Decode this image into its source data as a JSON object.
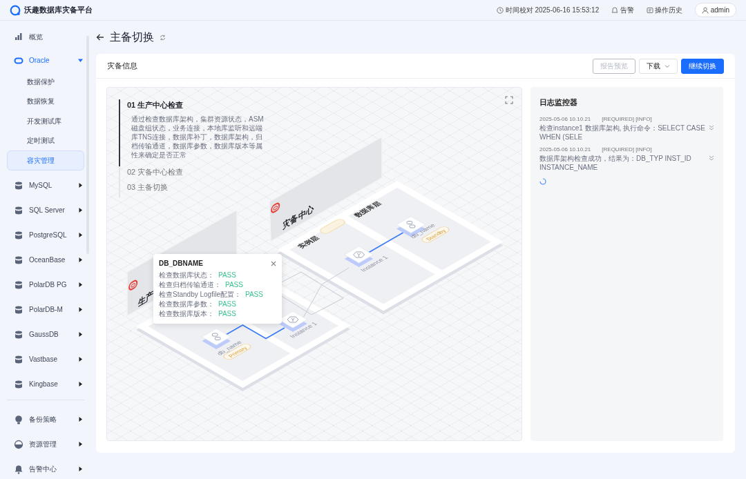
{
  "app": {
    "title": "沃趣数据库灾备平台"
  },
  "header": {
    "time": "时间校对 2025-06-16 15:53:12",
    "alarm": "告警",
    "history": "操作历史",
    "user": "admin"
  },
  "sidebar": {
    "groups": [
      [
        {
          "label": "概览",
          "kind": "link",
          "selected": false
        },
        {
          "label": "Oracle",
          "kind": "menu",
          "selected": true,
          "expanded": true,
          "children": [
            {
              "label": "数据保护",
              "selected": false
            },
            {
              "label": "数据恢复",
              "selected": false
            },
            {
              "label": "开发测试库",
              "selected": false
            },
            {
              "label": "定时测试",
              "selected": false
            },
            {
              "label": "容灾管理",
              "selected": true
            }
          ]
        },
        {
          "label": "MySQL",
          "kind": "menu",
          "selected": false,
          "expanded": false
        },
        {
          "label": "SQL Server",
          "kind": "menu",
          "selected": false,
          "expanded": false
        },
        {
          "label": "PostgreSQL",
          "kind": "menu",
          "selected": false,
          "expanded": false
        },
        {
          "label": "OceanBase",
          "kind": "menu",
          "selected": false,
          "expanded": false
        },
        {
          "label": "PolarDB PG",
          "kind": "menu",
          "selected": false,
          "expanded": false
        },
        {
          "label": "PolarDB-M",
          "kind": "menu",
          "selected": false,
          "expanded": false
        },
        {
          "label": "GaussDB",
          "kind": "menu",
          "selected": false,
          "expanded": false
        },
        {
          "label": "Vastbase",
          "kind": "menu",
          "selected": false,
          "expanded": false
        },
        {
          "label": "Kingbase",
          "kind": "menu",
          "selected": false,
          "expanded": false
        }
      ],
      [
        {
          "label": "备份策略",
          "kind": "menu",
          "selected": false,
          "expanded": false
        },
        {
          "label": "资源管理",
          "kind": "menu",
          "selected": false,
          "expanded": false
        },
        {
          "label": "告警中心",
          "kind": "menu",
          "selected": false,
          "expanded": false
        }
      ]
    ]
  },
  "page": {
    "title": "主备切换"
  },
  "card": {
    "title": "灾备信息",
    "buttons": [
      {
        "label": "报告预览",
        "kind": "outline",
        "disabled": true
      },
      {
        "label": "下载",
        "kind": "dropdown",
        "disabled": false
      },
      {
        "label": "继续切换",
        "kind": "primary",
        "disabled": false
      }
    ]
  },
  "steps": [
    {
      "label": "01 生产中心检查",
      "selected": true,
      "description": "通过检查数据库架构，集群资源状态，ASM磁盘组状态，业务连接，本地库监听和远端库TNS连接，数据库补丁，数据库架构，归档传输通道，数据库参数，数据库版本等属性来确定是否正常"
    },
    {
      "label": "02 灾备中心检查",
      "selected": false
    },
    {
      "label": "03 主备切换",
      "selected": false
    }
  ],
  "diagram": {
    "sites": [
      {
        "kind": "standby",
        "title": "灾备中心",
        "database_layer": "数据库层",
        "instance_layer": "实例层",
        "instance": "Instance 1",
        "database": "db_name",
        "role": "Standby"
      },
      {
        "kind": "primary",
        "title": "生产",
        "instance": "Instance 1",
        "database": "db_name",
        "role": "Primary"
      }
    ]
  },
  "tooltip": {
    "title": "DB_DBNAME",
    "checks": [
      {
        "label": "检查数据库状态：",
        "result": "PASS"
      },
      {
        "label": "检查归档传输通道：",
        "result": "PASS"
      },
      {
        "label": "检查Standby Logfile配置：",
        "result": "PASS"
      },
      {
        "label": "检查数据库参数：",
        "result": "PASS"
      },
      {
        "label": "检查数据库版本：",
        "result": "PASS"
      }
    ]
  },
  "log": {
    "title": "日志监控器",
    "loading": true,
    "entries": [
      {
        "time": "2025-05-06 10.10.21",
        "tags": "[REQUIRED] [INFO]",
        "message": "检查instance1 数据库架构, 执行命令：SELECT CASE WHEN (SELE"
      },
      {
        "time": "2025-05-06 10.10.21",
        "tags": "[REQUIRED] [INFO]",
        "message": "数据库架构检查成功，结果为：DB_TYP    INST_ID INSTANCE_NAME"
      }
    ]
  }
}
